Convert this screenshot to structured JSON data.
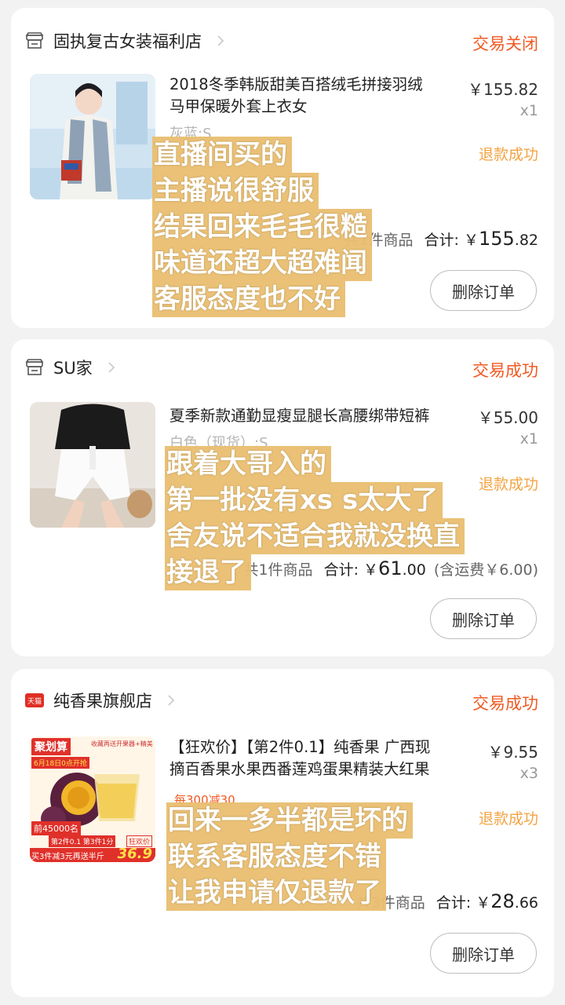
{
  "orders": [
    {
      "shop_name": "固执复古女装福利店",
      "status": "交易关闭",
      "title_line1": "2018冬季韩版甜美百搭绒毛拼接羽绒",
      "title_line2": "马甲保暖外套上衣女",
      "price": "￥155.82",
      "qty": "x1",
      "variant": "灰蓝;S",
      "refund_status": "退款成功",
      "count_label": "共1件商品",
      "total_label": "合计:",
      "total_currency": "￥",
      "total_int": "155",
      "total_dec": ".82",
      "shipping": "",
      "delete_label": "删除订单",
      "overlay_lines": [
        "直播间买的",
        "主播说很舒服",
        "结果回来毛毛很糙",
        "味道还超大超难闻",
        "客服态度也不好"
      ]
    },
    {
      "shop_name": "SU家",
      "status": "交易成功",
      "title_line1": "夏季新款通勤显瘦显腿长高腰绑带短裤",
      "title_line2": "",
      "price": "￥55.00",
      "qty": "x1",
      "variant": "白色（现货）;S",
      "refund_status": "退款成功",
      "count_label": "共1件商品",
      "total_label": "合计:",
      "total_currency": "￥",
      "total_int": "61",
      "total_dec": ".00",
      "shipping": "(含运费￥6.00)",
      "delete_label": "删除订单",
      "overlay_lines": [
        "跟着大哥入的",
        "第一批没有xs s太大了",
        "舍友说不适合我就没换直",
        "接退了"
      ]
    },
    {
      "shop_name": "纯香果旗舰店",
      "status": "交易成功",
      "title_line1": "【狂欢价】【第2件0.1】纯香果 广西现",
      "title_line2": "摘百香果水果西番莲鸡蛋果精装大红果",
      "price": "￥9.55",
      "qty": "x3",
      "variant": "",
      "promo": "每300减30",
      "refund_status": "退款成功",
      "count_label": "共3件商品",
      "total_label": "合计:",
      "total_currency": "￥",
      "total_int": "28",
      "total_dec": ".66",
      "shipping": "",
      "delete_label": "删除订单",
      "tmall_badge": "天猫",
      "overlay_lines": [
        "回来一多半都是坏的",
        "联系客服态度不错",
        "让我申请仅退款了"
      ]
    }
  ],
  "product_image_text": {
    "brand": "聚划算",
    "tagline": "收藏再送开果器+精美",
    "date": "6月18日0点开抢",
    "sold": "前45000名",
    "deal": "第2件0.1 第3件1分",
    "bottom": "买3件减3元再送半斤",
    "price_badge": "36.9",
    "event_badge": "狂欢价"
  },
  "colors": {
    "accent": "#f05a22",
    "refund": "#f3a444",
    "overlay": "#e9be70"
  }
}
